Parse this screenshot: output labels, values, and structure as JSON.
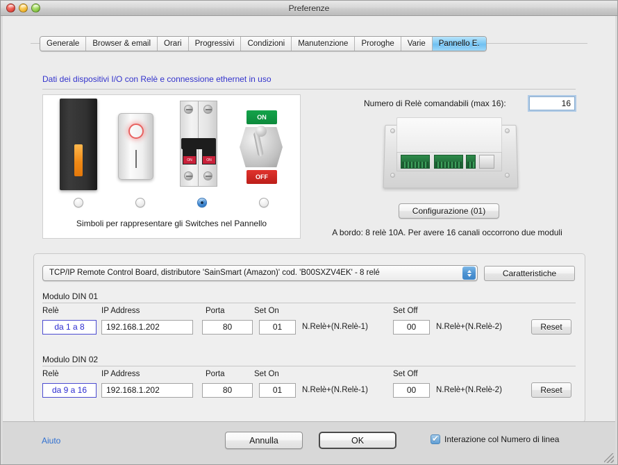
{
  "window": {
    "title": "Preferenze",
    "traffic_lights": [
      "close-button",
      "minimize-button",
      "zoom-button"
    ]
  },
  "tabs": [
    {
      "label": "Generale",
      "active": false
    },
    {
      "label": "Browser & email",
      "active": false
    },
    {
      "label": "Orari",
      "active": false
    },
    {
      "label": "Progressivi",
      "active": false
    },
    {
      "label": "Condizioni",
      "active": false
    },
    {
      "label": "Manutenzione",
      "active": false
    },
    {
      "label": "Proroghe",
      "active": false
    },
    {
      "label": "Varie",
      "active": false
    },
    {
      "label": "Pannello E.",
      "active": true
    }
  ],
  "section": {
    "title": "Dati dei dispositivi I/O con Relè e connessione ethernet in uso",
    "title_color": "#3333cc"
  },
  "switch_panel": {
    "caption": "Simboli per rappresentare gli Switches nel Pannello",
    "options": [
      {
        "name": "dark-slab-switch",
        "selected": false
      },
      {
        "name": "rocker-switch",
        "selected": false
      },
      {
        "name": "din-breaker-switch",
        "selected": true
      },
      {
        "name": "toggle-key-switch",
        "selected": false
      }
    ],
    "breaker_labels": {
      "on_left": "ON",
      "on_right": "ON"
    },
    "toggle_labels": {
      "on": "ON",
      "off": "OFF"
    }
  },
  "relay_count": {
    "label": "Numero di Relè comandabili (max 16):",
    "value": "16",
    "focus_color": "#7dafe1"
  },
  "configurazione": {
    "button_label": "Configurazione (01)",
    "note": "A bordo: 8 relè 10A. Per avere 16 canali occorrono due moduli"
  },
  "device": {
    "selected": "TCP/IP Remote Control Board, distributore 'SainSmart (Amazon)' cod. 'B00SXZV4EK' - 8 relé",
    "caratteristiche_label": "Caratteristiche"
  },
  "columns": {
    "rele": "Relè",
    "ip": "IP Address",
    "porta": "Porta",
    "set_on": "Set On",
    "set_off": "Set Off"
  },
  "modules": [
    {
      "title": "Modulo DIN 01",
      "rele_range": "da 1 a 8",
      "ip": "192.168.1.202",
      "porta": "80",
      "set_on": "01",
      "set_on_note": "N.Relè+(N.Relè-1)",
      "set_off": "00",
      "set_off_note": "N.Relè+(N.Relè-2)",
      "reset_label": "Reset"
    },
    {
      "title": "Modulo DIN 02",
      "rele_range": "da 9 a 16",
      "ip": "192.168.1.202",
      "porta": "80",
      "set_on": "01",
      "set_on_note": "N.Relè+(N.Relè-1)",
      "set_off": "00",
      "set_off_note": "N.Relè+(N.Relè-2)",
      "reset_label": "Reset"
    }
  ],
  "footer": {
    "help_label": "Aiuto",
    "cancel_label": "Annulla",
    "ok_label": "OK",
    "checkbox_label": "Interazione col Numero di linea",
    "checkbox_checked": true,
    "accent_color": "#5e9dd4",
    "link_color": "#2f6fd0"
  }
}
